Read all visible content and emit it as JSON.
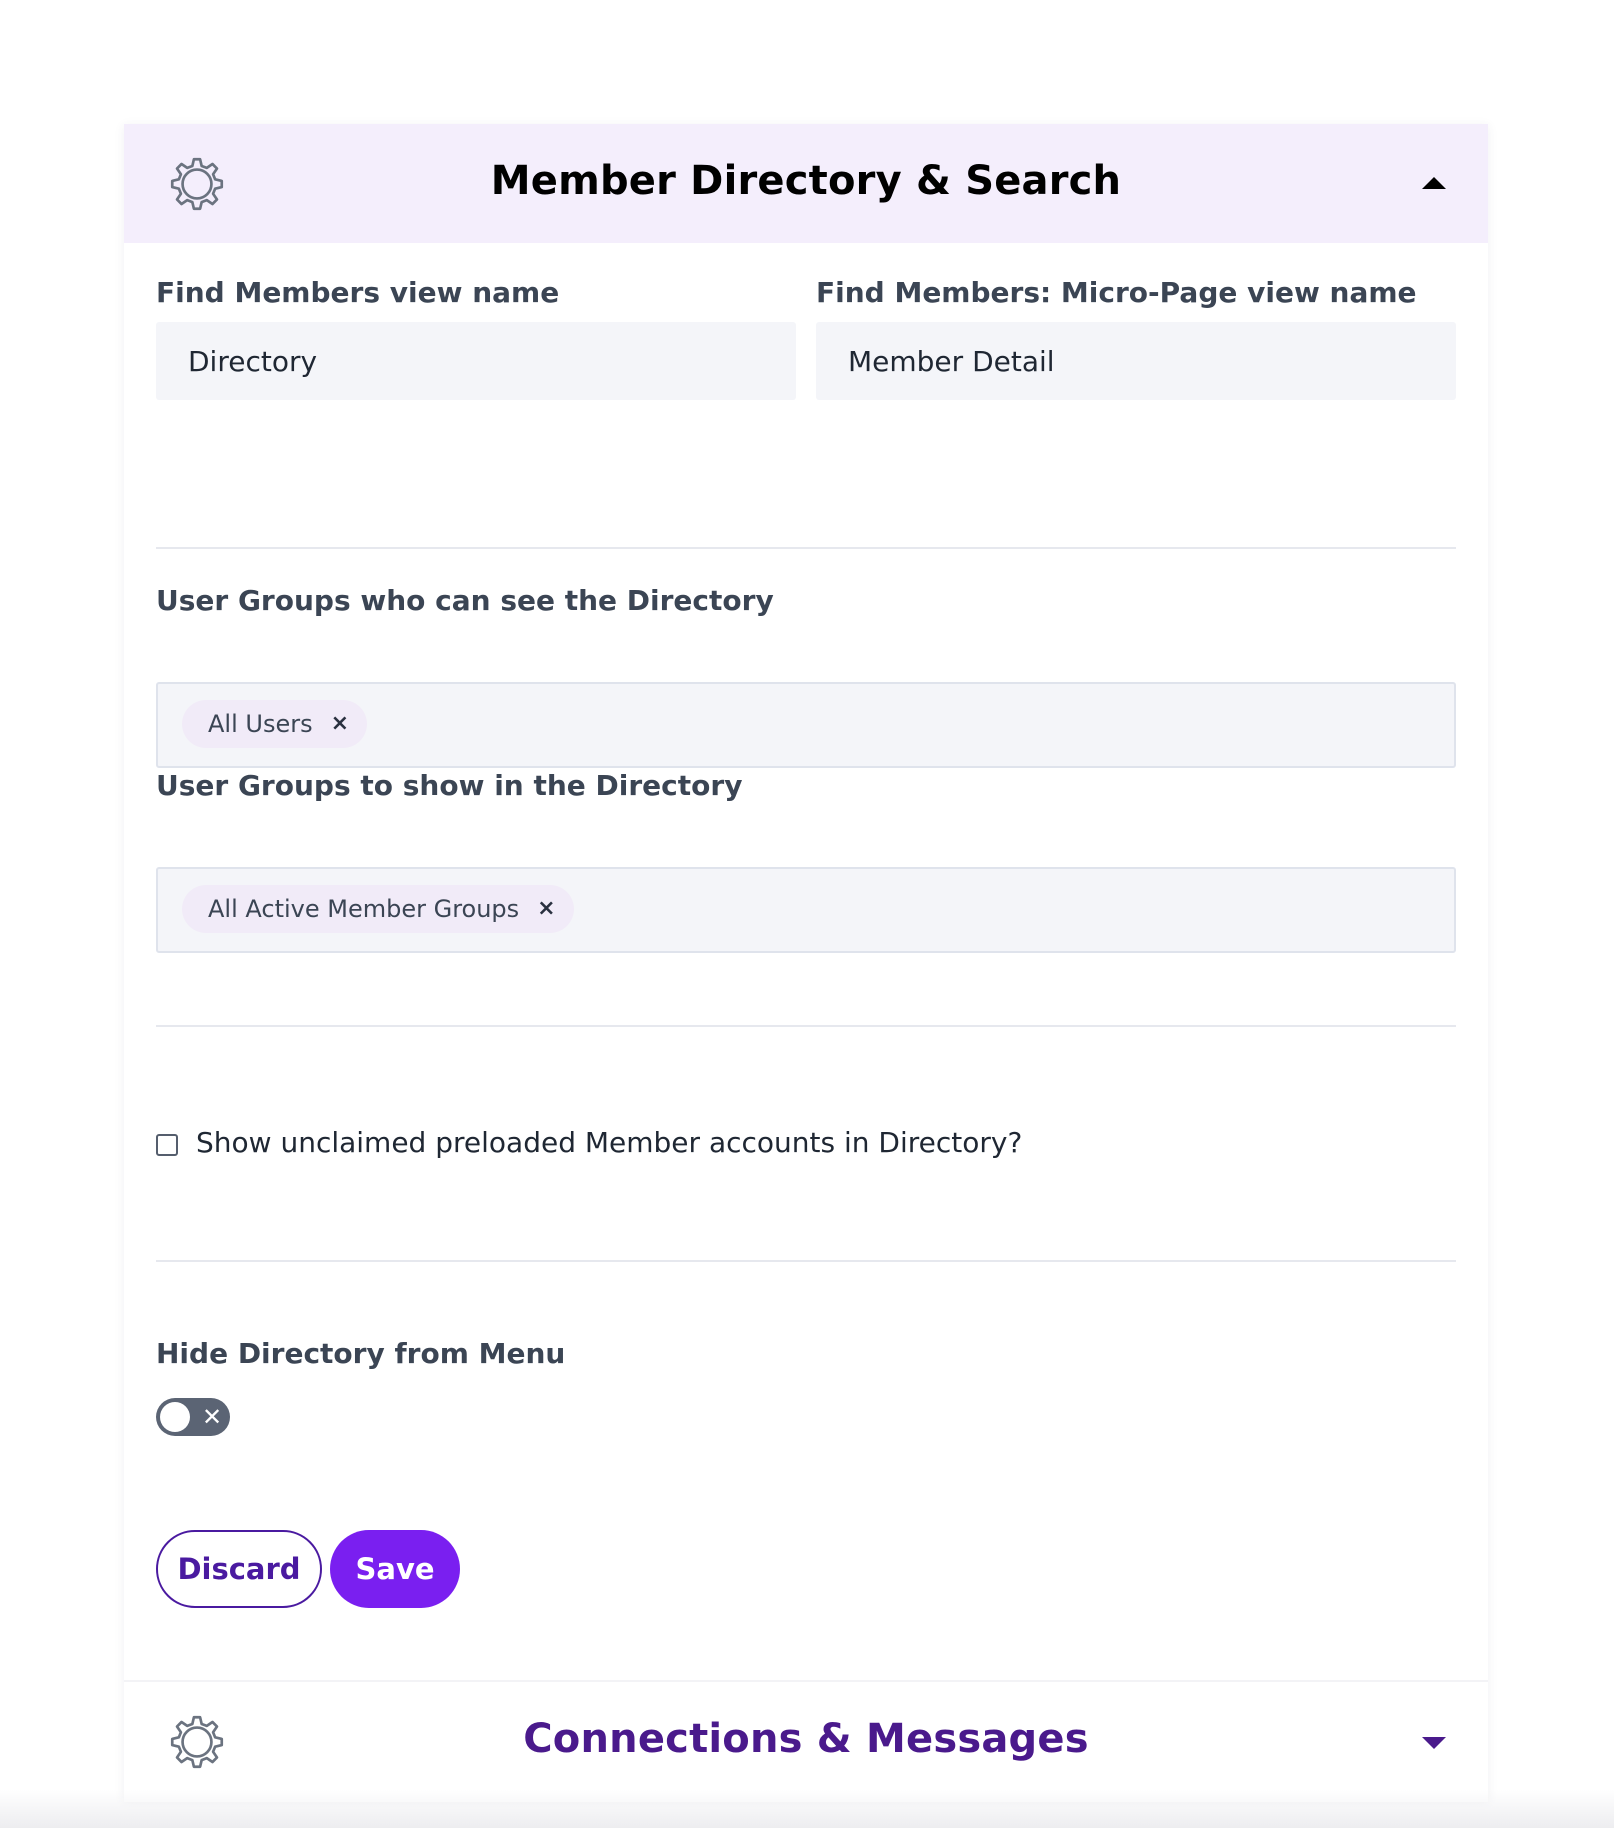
{
  "panel": {
    "title": "Member Directory & Search",
    "icon": "gear-icon",
    "header_bg": "#f4eefc"
  },
  "fields": {
    "find_members_label": "Find Members view name",
    "find_members_value": "Directory",
    "micro_page_label": "Find Members: Micro-Page view name",
    "micro_page_value": "Member Detail"
  },
  "groups_see": {
    "label": "User Groups who can see the Directory",
    "tags": [
      "All Users"
    ]
  },
  "groups_show": {
    "label": "User Groups to show in the Directory",
    "tags": [
      "All Active Member Groups"
    ]
  },
  "unclaimed": {
    "label": "Show unclaimed preloaded Member accounts in Directory?",
    "checked": false
  },
  "hide_directory": {
    "label": "Hide Directory from Menu",
    "enabled": false
  },
  "actions": {
    "discard": "Discard",
    "save": "Save",
    "primary_color": "#7a1ff0"
  },
  "next_panel": {
    "title": "Connections & Messages",
    "icon": "gear-icon",
    "title_color": "#4a1a8c"
  }
}
